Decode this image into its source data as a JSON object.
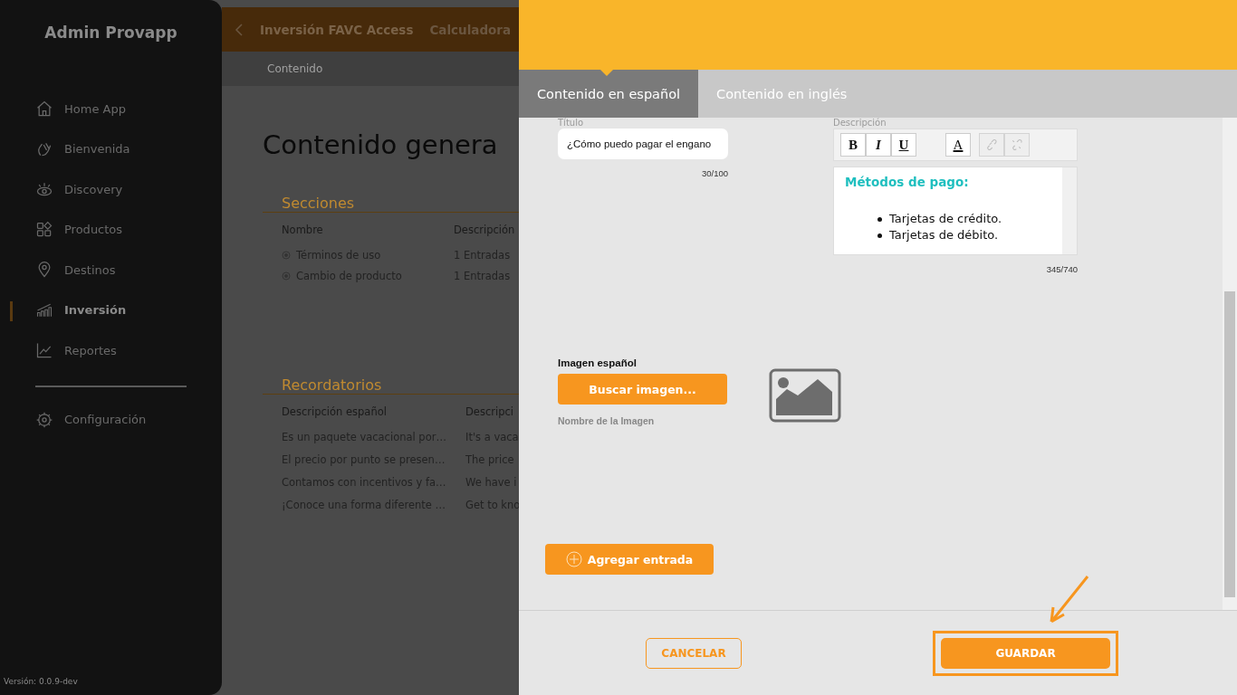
{
  "sidebar": {
    "title": "Admin Provapp",
    "items": [
      {
        "label": "Home App",
        "selected": false
      },
      {
        "label": "Bienvenida",
        "selected": false
      },
      {
        "label": "Discovery",
        "selected": false
      },
      {
        "label": "Productos",
        "selected": false
      },
      {
        "label": "Destinos",
        "selected": false
      },
      {
        "label": "Inversión",
        "selected": true
      },
      {
        "label": "Reportes",
        "selected": false
      }
    ],
    "settings_item": {
      "label": "Configuración",
      "selected": false
    },
    "version": "Versión: 0.0.9-dev"
  },
  "background_page": {
    "header_tabs": [
      {
        "label": "Inversión FAVC Access",
        "selected": true
      },
      {
        "label": "Calculadora",
        "selected": false
      }
    ],
    "breadcrumb": "Contenido",
    "heading": "Contenido genera",
    "sections": {
      "title": "Secciones",
      "columns": [
        "Nombre",
        "Descripción"
      ],
      "rows": [
        {
          "name": "Términos de uso",
          "description": "1 Entradas"
        },
        {
          "name": "Cambio de producto",
          "description": "1 Entradas"
        }
      ]
    },
    "reminders": {
      "title": "Recordatorios",
      "columns": [
        "Descripción español",
        "Descripci"
      ],
      "rows": [
        [
          "Es un paquete vacacional por…",
          "It's a vaca"
        ],
        [
          "El precio por punto se presen…",
          "The price"
        ],
        [
          "Contamos con incentivos y fa…",
          "We have i"
        ],
        [
          "¡Conoce una forma diferente …",
          "Get to kno"
        ]
      ]
    }
  },
  "editor_panel": {
    "tabs": [
      {
        "label": "Contenido en español",
        "selected": true
      },
      {
        "label": "Contenido en inglés",
        "selected": false
      }
    ],
    "title_field": {
      "label": "Título",
      "value": "¿Cómo puedo pagar el engano",
      "counter": "30/100"
    },
    "description": {
      "label": "Descripción",
      "toolbar": [
        {
          "kind": "bold",
          "label": "B",
          "disabled": false
        },
        {
          "kind": "italic",
          "label": "I",
          "disabled": false
        },
        {
          "kind": "underline",
          "label": "U",
          "disabled": false
        },
        {
          "kind": "color",
          "label": "A",
          "disabled": false
        },
        {
          "kind": "link",
          "disabled": true
        },
        {
          "kind": "unlink",
          "disabled": true
        }
      ],
      "heading": "Métodos de pago:",
      "items": [
        "Tarjetas de crédito.",
        "Tarjetas de débito."
      ],
      "counter": "345/740"
    },
    "image": {
      "label": "Imagen español",
      "button": "Buscar imagen...",
      "file_name": "Nombre de la Imagen"
    },
    "add_entry_button": "Agregar entrada",
    "cancel_button": "CANCELAR",
    "save_button": "GUARDAR"
  }
}
